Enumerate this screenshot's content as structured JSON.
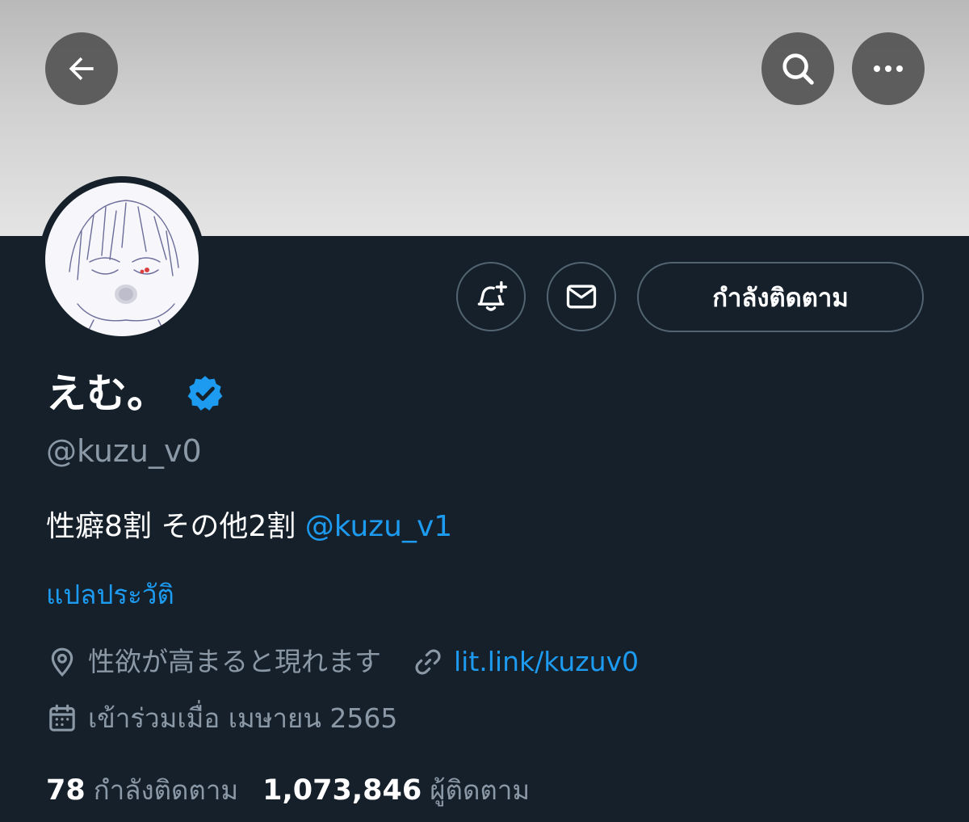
{
  "profile": {
    "display_name": "えむ。",
    "handle": "@kuzu_v0",
    "bio_text": "性癖8割 その他2割 ",
    "bio_mention": "@kuzu_v1",
    "translate_label": "แปลประวัติ",
    "location": "性欲が高まると現れます",
    "link": "lit.link/kuzuv0",
    "joined": "เข้าร่วมเมื่อ เมษายน 2565"
  },
  "actions": {
    "follow_label": "กำลังติดตาม"
  },
  "stats": {
    "following_count": "78",
    "following_label": "กำลังติดตาม",
    "followers_count": "1,073,846",
    "followers_label": "ผู้ติดตาม"
  },
  "icons": [
    "back-arrow-icon",
    "search-icon",
    "more-icon",
    "notification-bell-plus-icon",
    "mail-icon",
    "verified-badge-icon",
    "location-pin-icon",
    "link-icon",
    "calendar-icon"
  ],
  "colors": {
    "background": "#15202b",
    "accent": "#1d9bf0",
    "secondary_text": "#8b98a5",
    "border": "#536471"
  }
}
